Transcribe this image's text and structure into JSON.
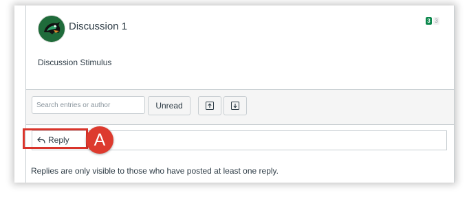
{
  "discussion": {
    "title": "Discussion 1",
    "stimulus": "Discussion Stimulus",
    "unread_count": "3",
    "total_count": "3",
    "colors": {
      "unread_badge": "#0b874b",
      "avatar_bg": "#1f6b3a"
    }
  },
  "toolbar": {
    "search_placeholder": "Search entries or author",
    "unread_label": "Unread",
    "expand_icon": "collapse-up-icon",
    "collapse_icon": "expand-down-icon"
  },
  "reply": {
    "label": "Reply",
    "icon": "reply-arrow-icon"
  },
  "annotation": {
    "callout_label": "A",
    "color": "#dd3a2e"
  },
  "note": "Replies are only visible to those who have posted at least one reply."
}
